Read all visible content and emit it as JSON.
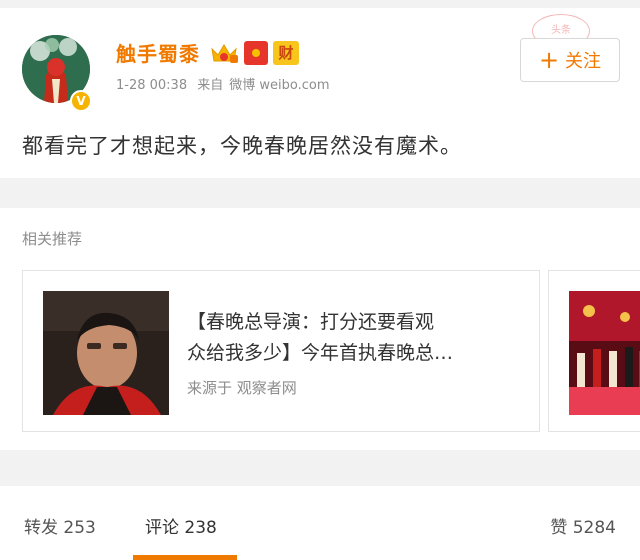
{
  "post": {
    "username": "触手蜀黍",
    "time": "1-28 00:38",
    "source_prefix": "来自",
    "source": "微博 weibo.com",
    "follow_label": "关注",
    "cai_badge": "财",
    "verified_badge": "V",
    "text": "都看完了才想起来，今晚春晚居然没有魔术。",
    "stamp_text": "头条"
  },
  "recommend": {
    "title": "相关推荐",
    "card": {
      "line1": "【春晚总导演：打分还要看观",
      "line2": "众给我多少】今年首执春晚总…",
      "source": "来源于 观察者网"
    }
  },
  "tabs": {
    "repost": "转发",
    "repost_count": "253",
    "comment": "评论",
    "comment_count": "238",
    "like": "赞",
    "like_count": "5284"
  },
  "colors": {
    "accent": "#f07a00",
    "gold": "#f6b400",
    "red": "#e6352b"
  }
}
